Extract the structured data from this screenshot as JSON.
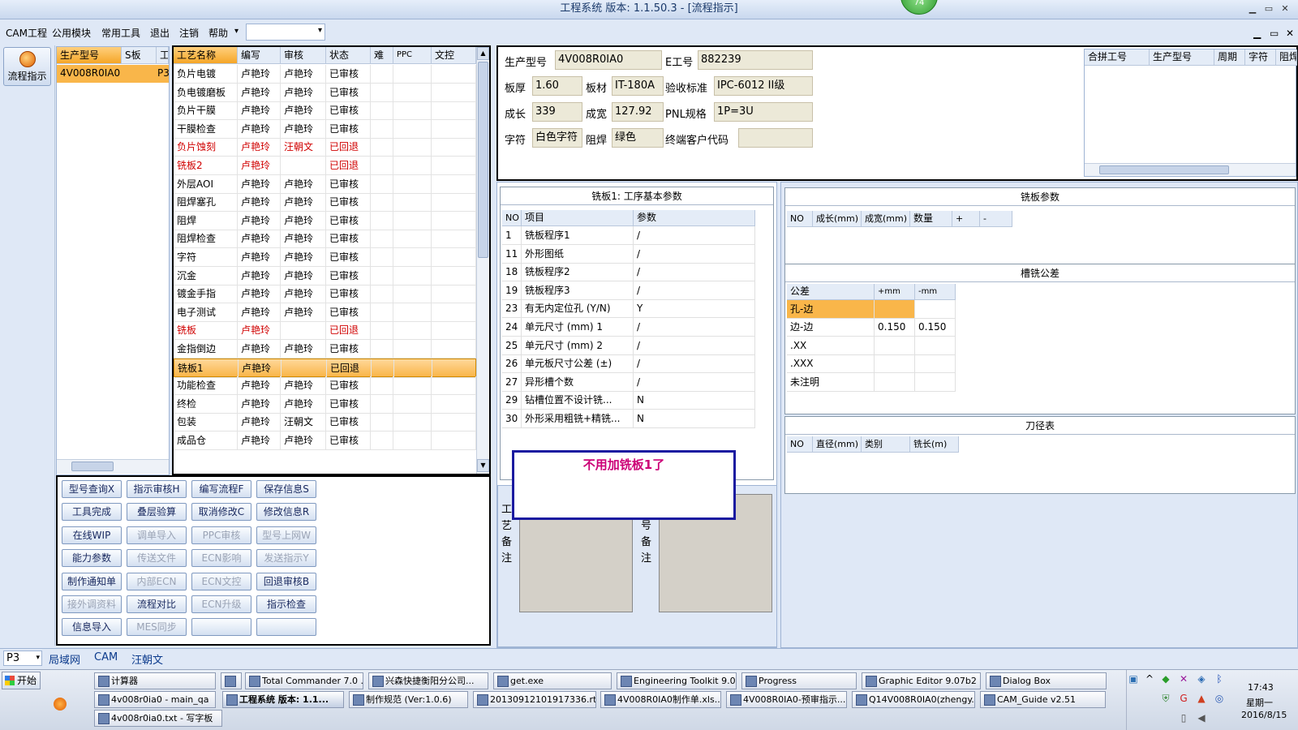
{
  "window": {
    "title": "工程系统  版本: 1.1.50.3 - [流程指示]",
    "badge": "74",
    "min": "▁",
    "max": "▭",
    "close": "✕"
  },
  "menu": {
    "items": [
      "CAM工程",
      "公用模块",
      "常用工具",
      "退出",
      "注销",
      "帮助"
    ],
    "help_arrow": "▾",
    "mdi_min": "▁",
    "mdi_max": "▭",
    "mdi_close": "✕"
  },
  "left_tool": {
    "label": "流程指示"
  },
  "model_list": {
    "headers": [
      "生产型号",
      "S板",
      "工"
    ],
    "rows": [
      [
        "4V008R0IA0",
        "",
        "P3"
      ]
    ]
  },
  "process_grid": {
    "headers": [
      "工艺名称",
      "编写",
      "审核",
      "状态",
      "难",
      "PPC",
      "文控"
    ],
    "rows": [
      {
        "name": "负片电镀",
        "writer": "卢艳玲",
        "reviewer": "卢艳玲",
        "status": "已审核",
        "red": false
      },
      {
        "name": "负电镀磨板",
        "writer": "卢艳玲",
        "reviewer": "卢艳玲",
        "status": "已审核",
        "red": false
      },
      {
        "name": "负片干膜",
        "writer": "卢艳玲",
        "reviewer": "卢艳玲",
        "status": "已审核",
        "red": false
      },
      {
        "name": "干膜检查",
        "writer": "卢艳玲",
        "reviewer": "卢艳玲",
        "status": "已审核",
        "red": false
      },
      {
        "name": "负片蚀刻",
        "writer": "卢艳玲",
        "reviewer": "汪朝文",
        "status": "已回退",
        "red": true
      },
      {
        "name": "铣板2",
        "writer": "卢艳玲",
        "reviewer": "",
        "status": "已回退",
        "red": true
      },
      {
        "name": "外层AOI",
        "writer": "卢艳玲",
        "reviewer": "卢艳玲",
        "status": "已审核",
        "red": false
      },
      {
        "name": "阻焊塞孔",
        "writer": "卢艳玲",
        "reviewer": "卢艳玲",
        "status": "已审核",
        "red": false
      },
      {
        "name": "阻焊",
        "writer": "卢艳玲",
        "reviewer": "卢艳玲",
        "status": "已审核",
        "red": false
      },
      {
        "name": "阻焊检查",
        "writer": "卢艳玲",
        "reviewer": "卢艳玲",
        "status": "已审核",
        "red": false
      },
      {
        "name": "字符",
        "writer": "卢艳玲",
        "reviewer": "卢艳玲",
        "status": "已审核",
        "red": false
      },
      {
        "name": "沉金",
        "writer": "卢艳玲",
        "reviewer": "卢艳玲",
        "status": "已审核",
        "red": false
      },
      {
        "name": "镀金手指",
        "writer": "卢艳玲",
        "reviewer": "卢艳玲",
        "status": "已审核",
        "red": false
      },
      {
        "name": "电子测试",
        "writer": "卢艳玲",
        "reviewer": "卢艳玲",
        "status": "已审核",
        "red": false
      },
      {
        "name": "铣板",
        "writer": "卢艳玲",
        "reviewer": "",
        "status": "已回退",
        "red": true
      },
      {
        "name": "金指倒边",
        "writer": "卢艳玲",
        "reviewer": "卢艳玲",
        "status": "已审核",
        "red": false
      },
      {
        "name": "铣板1",
        "writer": "卢艳玲",
        "reviewer": "",
        "status": "已回退",
        "red": false,
        "selected": true
      },
      {
        "name": "功能检查",
        "writer": "卢艳玲",
        "reviewer": "卢艳玲",
        "status": "已审核",
        "red": false
      },
      {
        "name": "终检",
        "writer": "卢艳玲",
        "reviewer": "卢艳玲",
        "status": "已审核",
        "red": false
      },
      {
        "name": "包装",
        "writer": "卢艳玲",
        "reviewer": "汪朝文",
        "status": "已审核",
        "red": false
      },
      {
        "name": "成品仓",
        "writer": "卢艳玲",
        "reviewer": "卢艳玲",
        "status": "已审核",
        "red": false
      }
    ]
  },
  "buttons": [
    {
      "label": "型号查询X",
      "enabled": true
    },
    {
      "label": "指示审核H",
      "enabled": true
    },
    {
      "label": "编写流程F",
      "enabled": true
    },
    {
      "label": "保存信息S",
      "enabled": true
    },
    {
      "label": "工具完成",
      "enabled": true
    },
    {
      "label": "叠层验算",
      "enabled": true
    },
    {
      "label": "取消修改C",
      "enabled": true
    },
    {
      "label": "修改信息R",
      "enabled": true
    },
    {
      "label": "在线WIP",
      "enabled": true
    },
    {
      "label": "调单导入",
      "enabled": false
    },
    {
      "label": "PPC审核",
      "enabled": false
    },
    {
      "label": "型号上网W",
      "enabled": false
    },
    {
      "label": "能力参数",
      "enabled": true
    },
    {
      "label": "传送文件",
      "enabled": false
    },
    {
      "label": "ECN影响",
      "enabled": false
    },
    {
      "label": "发送指示Y",
      "enabled": false
    },
    {
      "label": "制作通知单",
      "enabled": true
    },
    {
      "label": "内部ECN",
      "enabled": false
    },
    {
      "label": "ECN文控",
      "enabled": false
    },
    {
      "label": "回退审核B",
      "enabled": true
    },
    {
      "label": "接外调资料",
      "enabled": false
    },
    {
      "label": "流程对比",
      "enabled": true
    },
    {
      "label": "ECN升级",
      "enabled": false
    },
    {
      "label": "指示检查",
      "enabled": true
    },
    {
      "label": "信息导入",
      "enabled": true
    },
    {
      "label": "MES同步",
      "enabled": false
    },
    {
      "label": "",
      "enabled": true
    },
    {
      "label": "",
      "enabled": true
    }
  ],
  "info": {
    "model_label": "生产型号",
    "model": "4V008R0IA0",
    "e_label": "E工号",
    "e_no": "882239",
    "thick_label": "板厚",
    "thick": "1.60",
    "mat_label": "板材",
    "mat": "IT-180A",
    "std_label": "验收标准",
    "std": "IPC-6012 II级",
    "len_label": "成长",
    "len": "339",
    "wid_label": "成宽",
    "wid": "127.92",
    "pnl_label": "PNL规格",
    "pnl": "1P=3U",
    "char_label": "字符",
    "char": "白色字符",
    "mask_label": "阻焊",
    "mask": "绿色",
    "cust_label": "终端客户代码",
    "cust": ""
  },
  "merge_grid": {
    "headers": [
      "合拼工号",
      "生产型号",
      "周期",
      "字符",
      "阻焊"
    ]
  },
  "params": {
    "title": "铣板1: 工序基本参数",
    "headers": [
      "NO",
      "项目",
      "参数"
    ],
    "rows": [
      [
        "1",
        "铣板程序1",
        "/"
      ],
      [
        "11",
        "外形图纸",
        "/"
      ],
      [
        "18",
        "铣板程序2",
        "/"
      ],
      [
        "19",
        "铣板程序3",
        "/"
      ],
      [
        "23",
        "有无内定位孔 (Y/N)",
        "Y"
      ],
      [
        "24",
        "单元尺寸 (mm) 1",
        "/"
      ],
      [
        "25",
        "单元尺寸 (mm) 2",
        "/"
      ],
      [
        "26",
        "单元板尺寸公差 (±)",
        "/"
      ],
      [
        "27",
        "异形槽个数",
        "/"
      ],
      [
        "29",
        "钻槽位置不设计铣...",
        "N"
      ],
      [
        "30",
        "外形采用粗铣+精铣...",
        "N"
      ]
    ]
  },
  "note_popup": {
    "text": "不用加铣板1了"
  },
  "remarks": {
    "process_label": "工艺备注",
    "model_label": "型号备注"
  },
  "mill_params": {
    "title": "铣板参数",
    "headers": [
      "NO",
      "成长(mm)",
      "成宽(mm)",
      "数量",
      "+",
      "-"
    ]
  },
  "slot_tol": {
    "title": "槽铣公差",
    "headers": [
      "公差",
      "+mm",
      "-mm"
    ],
    "rows": [
      [
        "孔-边",
        "",
        ""
      ],
      [
        "边-边",
        "0.150",
        "0.150"
      ],
      [
        ".XX",
        "",
        ""
      ],
      [
        ".XXX",
        "",
        ""
      ],
      [
        "未注明",
        "",
        ""
      ]
    ]
  },
  "tool_table": {
    "title": "刀径表",
    "headers": [
      "NO",
      "直径(mm)",
      "类别",
      "铣长(m)"
    ]
  },
  "statusbar": {
    "combo": "P3",
    "tabs": [
      "局域网",
      "CAM",
      "汪朝文"
    ]
  },
  "taskbar": {
    "start": "开始",
    "row1": [
      "计算器",
      "",
      "Total Commander 7.0 ...",
      "兴森快捷衡阳分公司...",
      "get.exe",
      "Engineering Toolkit 9.0...",
      "Progress",
      "Graphic Editor 9.07b2 (...",
      "Dialog Box"
    ],
    "row2": [
      "4v008r0ia0 - main_qa",
      "工程系统  版本: 1.1...",
      "制作规范 (Ver:1.0.6)",
      "20130912101917336.rt...",
      "4V008R0IA0制作单.xls...",
      "4V008R0IA0-预审指示...",
      "Q14V008R0IA0(zhengy...",
      "CAM_Guide v2.51"
    ],
    "row3": [
      "4v008r0ia0.txt - 写字板"
    ],
    "time": "17:43",
    "weekday": "星期一",
    "date": "2016/8/15"
  },
  "colors": {
    "accent": "#f5a628",
    "red": "#d00000",
    "popup_text": "#cc0077",
    "popup_border": "#1a1aa0"
  }
}
